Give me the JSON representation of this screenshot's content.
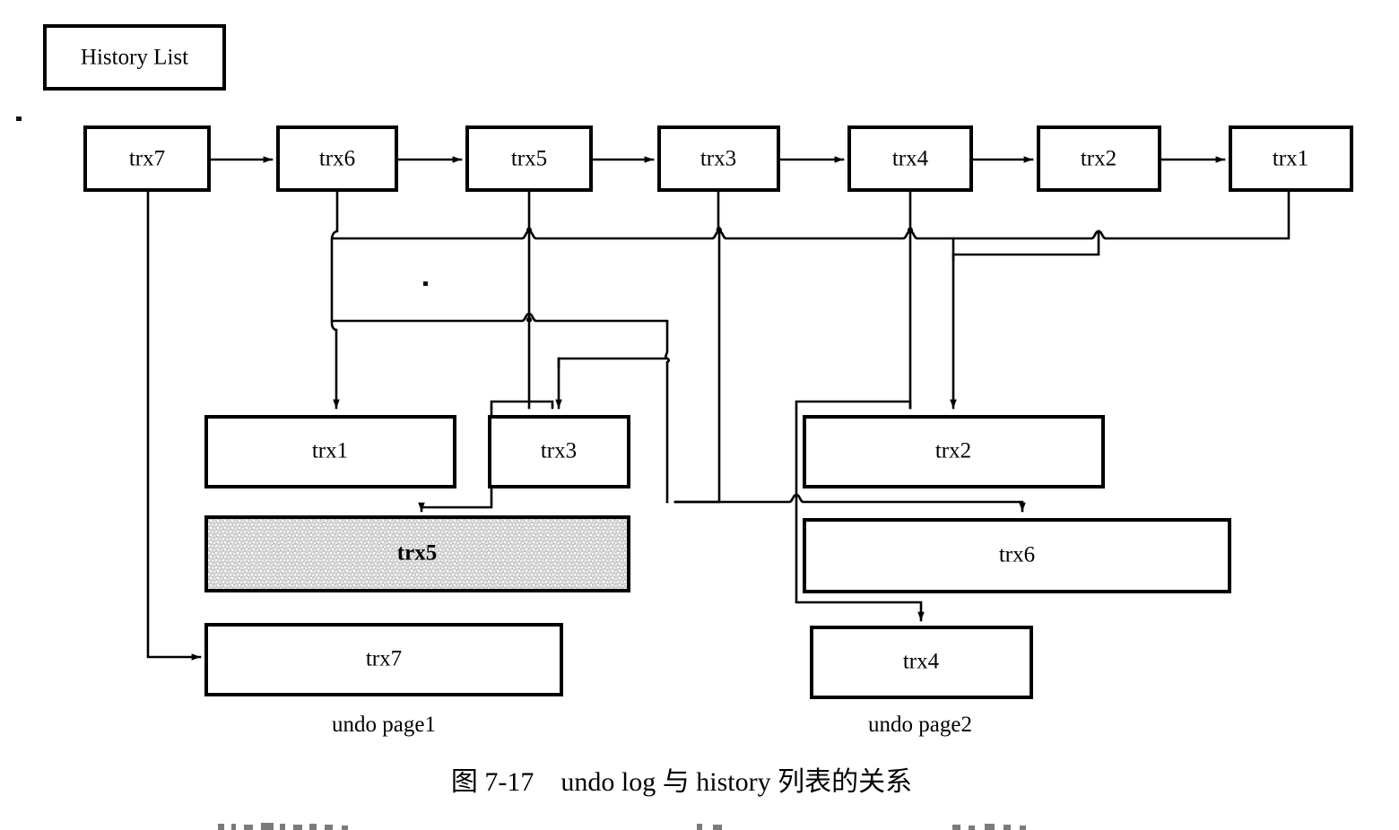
{
  "figure": {
    "caption": "图 7-17　undo log 与 history 列表的关系",
    "history_list_label": "History List"
  },
  "history_list": {
    "label": "History List",
    "nodes": [
      {
        "label": "trx7"
      },
      {
        "label": "trx6"
      },
      {
        "label": "trx5"
      },
      {
        "label": "trx3"
      },
      {
        "label": "trx4"
      },
      {
        "label": "trx2"
      },
      {
        "label": "trx1"
      }
    ]
  },
  "undo_pages": [
    {
      "caption": "undo page1",
      "entries": [
        {
          "label": "trx1",
          "shaded": "false"
        },
        {
          "label": "trx3",
          "shaded": "false"
        },
        {
          "label": "trx5",
          "shaded": "true"
        },
        {
          "label": "trx7",
          "shaded": "false"
        }
      ]
    },
    {
      "caption": "undo page2",
      "entries": [
        {
          "label": "trx2",
          "shaded": "false"
        },
        {
          "label": "trx6",
          "shaded": "false"
        },
        {
          "label": "trx4",
          "shaded": "false"
        }
      ]
    }
  ],
  "colors": {
    "stroke": "#000000",
    "box_fill": "#ffffff",
    "shaded_fill": "#d0d0d0",
    "background": "#ffffff"
  }
}
